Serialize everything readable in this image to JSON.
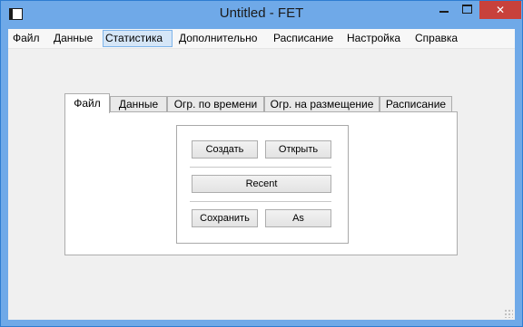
{
  "window": {
    "title": "Untitled - FET",
    "close_label": "✕"
  },
  "menubar": {
    "items": [
      "Файл",
      "Данные",
      "Статистика",
      "Дополнительно",
      "Расписание",
      "Настройка",
      "Справка"
    ]
  },
  "tabs": [
    "Файл",
    "Данные",
    "Огр. по времени",
    "Огр. на размещение",
    "Расписание"
  ],
  "file_panel": {
    "new_label": "Создать",
    "open_label": "Открыть",
    "recent_label": "Recent",
    "save_label": "Сохранить",
    "save_as_label": "As"
  }
}
